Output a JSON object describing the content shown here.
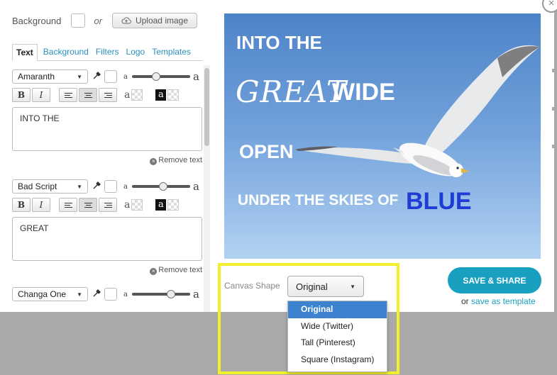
{
  "background": {
    "label": "Background",
    "or": "or",
    "upload_label": "Upload image"
  },
  "tabs": [
    {
      "label": "Text"
    },
    {
      "label": "Background"
    },
    {
      "label": "Filters"
    },
    {
      "label": "Logo"
    },
    {
      "label": "Templates"
    }
  ],
  "text_layers": [
    {
      "font": "Amaranth",
      "text": "INTO THE",
      "size_level": 0.4
    },
    {
      "font": "Bad Script",
      "text": "GREAT",
      "size_level": 0.55
    },
    {
      "font": "Changa One",
      "text": "",
      "size_level": 0.7
    }
  ],
  "controls": {
    "bold": "B",
    "italic": "I",
    "small_a": "a",
    "big_a": "a",
    "outline_a": "a",
    "shadow_a": "a",
    "remove_label": "Remove text",
    "remove_icon": "×"
  },
  "canvas": {
    "lines": [
      "INTO THE",
      "GREAT",
      "WIDE",
      "OPEN",
      "UNDER THE SKIES OF",
      "BLUE"
    ]
  },
  "canvas_shape": {
    "label": "Canvas Shape",
    "selected": "Original",
    "options": [
      "Original",
      "Wide (Twitter)",
      "Tall (Pinterest)",
      "Square (Instagram)"
    ]
  },
  "actions": {
    "save_share": "SAVE & SHARE",
    "or": "or",
    "save_template": "save as template"
  },
  "icons": {
    "close": "×",
    "dropper": "eyedropper-icon",
    "caret": "▼"
  },
  "colors": {
    "accent": "#19a0c1",
    "highlight": "#f2f02a",
    "menu_selected": "#3d82ce",
    "blue_text": "#1e3dd4"
  }
}
